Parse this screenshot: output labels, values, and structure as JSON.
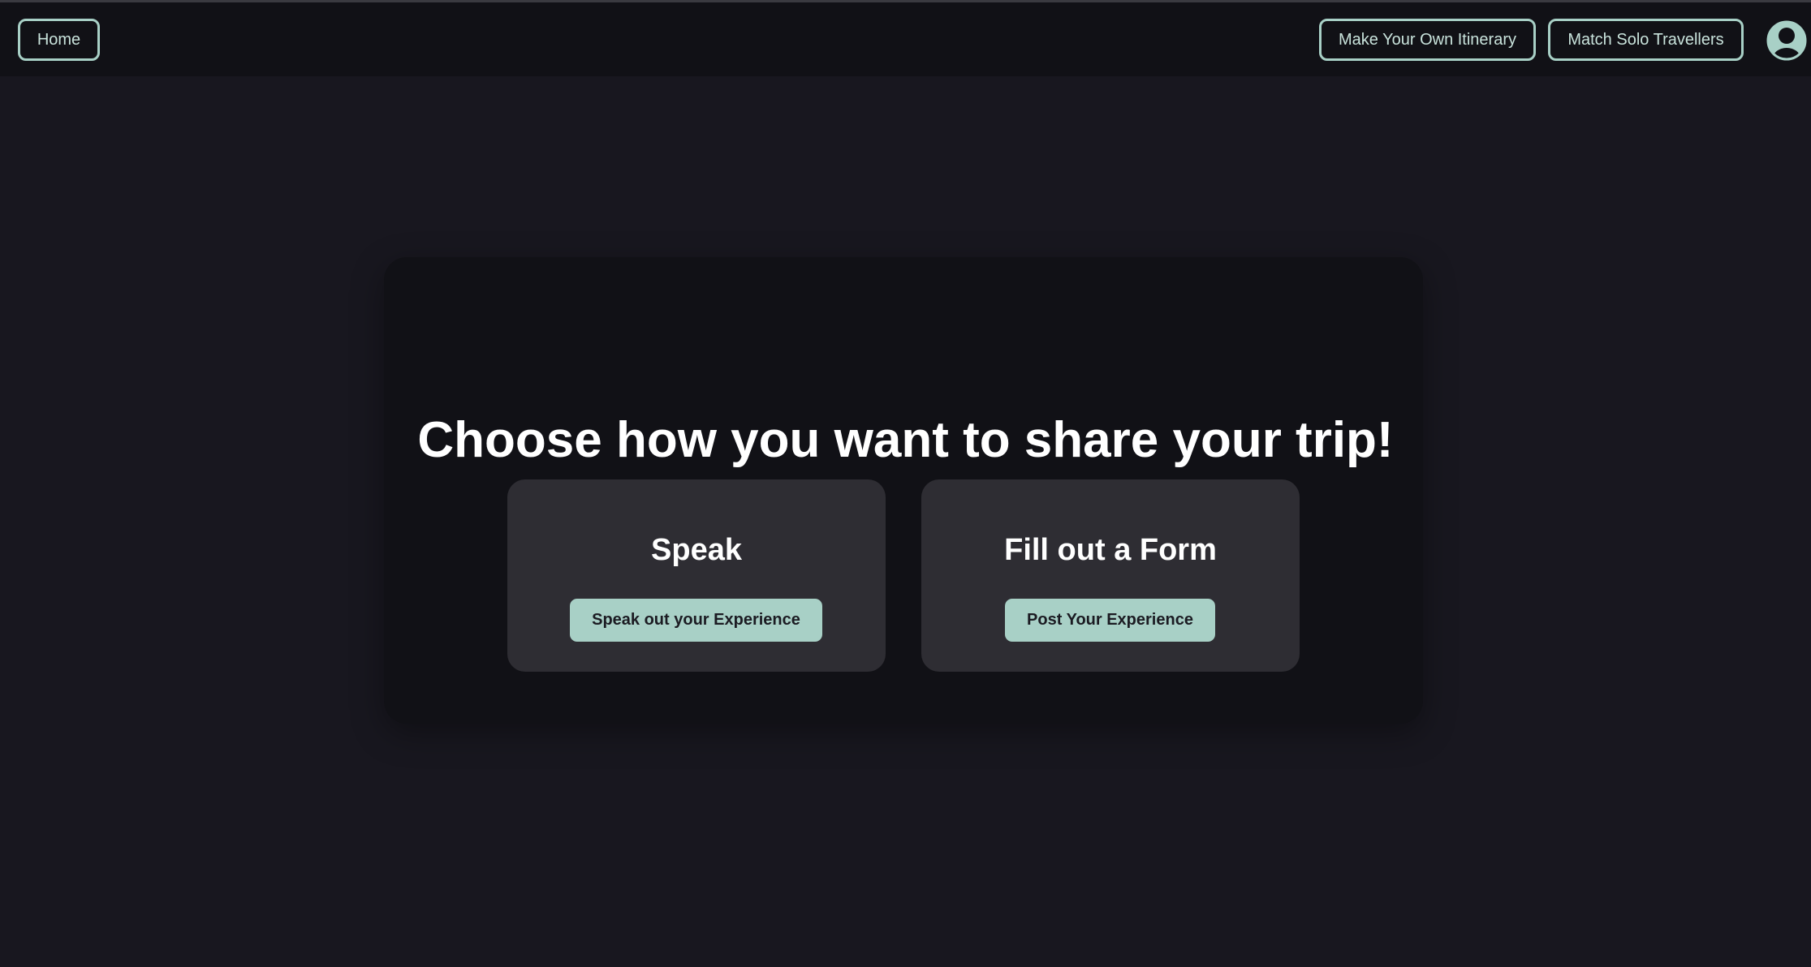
{
  "nav": {
    "home_label": "Home",
    "itinerary_label": "Make Your Own Itinerary",
    "match_label": "Match Solo Travellers",
    "profile_icon": "user-circle-icon"
  },
  "main": {
    "headline": "Choose how you want to share your trip!",
    "cards": [
      {
        "title": "Speak",
        "button_label": "Speak out your Experience"
      },
      {
        "title": "Fill out a Form",
        "button_label": "Post Your Experience"
      }
    ]
  },
  "colors": {
    "page_background": "#18171f",
    "navbar_background": "#111116",
    "panel_background": "#111116",
    "card_background": "#2e2d33",
    "accent": "#a8d0c6",
    "text_primary": "#ffffff"
  }
}
